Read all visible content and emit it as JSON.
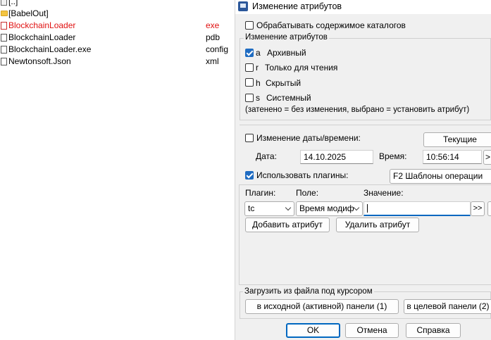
{
  "files": [
    {
      "name": "[..]",
      "ext": "",
      "icon": "up-dir-icon",
      "color": "#000000"
    },
    {
      "name": "[BabelOut]",
      "ext": "",
      "icon": "folder-icon",
      "color": "#000000"
    },
    {
      "name": "BlockchainLoader",
      "ext": "exe",
      "icon": "executable-file-icon",
      "color": "#e01010"
    },
    {
      "name": "BlockchainLoader",
      "ext": "pdb",
      "icon": "file-icon",
      "color": "#000000"
    },
    {
      "name": "BlockchainLoader.exe",
      "ext": "config",
      "icon": "file-icon",
      "color": "#000000"
    },
    {
      "name": "Newtonsoft.Json",
      "ext": "xml",
      "icon": "file-icon",
      "color": "#000000"
    }
  ],
  "dialog": {
    "title": "Изменение атрибутов",
    "process_subdirs_label": "Обрабатывать содержимое каталогов",
    "attributes_group_label": "Изменение атрибутов",
    "attributes": [
      {
        "key": "a",
        "label": "Архивный",
        "checked": true
      },
      {
        "key": "r",
        "label": "Только для чтения",
        "checked": false
      },
      {
        "key": "h",
        "label": "Скрытый",
        "checked": false
      },
      {
        "key": "s",
        "label": "Системный",
        "checked": false
      }
    ],
    "attributes_hint": "(затенено = без изменения, выбрано = установить атрибут)",
    "datetime_label": "Изменение даты/времени:",
    "current_button": "Текущие",
    "date_label": "Дата:",
    "date_value": "14.10.2025",
    "time_label": "Время:",
    "time_value": "10:56:14",
    "time_more_button": ">",
    "use_plugins_label": "Использовать плагины:",
    "plugin_templates_value": "F2 Шаблоны операции",
    "plugin_col_label": "Плагин:",
    "field_col_label": "Поле:",
    "value_col_label": "Значение:",
    "plugin_value": "tc",
    "field_value": "Время модиф",
    "value_input": "",
    "expand_button": ">>",
    "add_attr_button": "Добавить атрибут",
    "remove_attr_button": "Удалить атрибут",
    "load_from_file_label": "Загрузить из файла под курсором",
    "source_panel_button": "в исходной (активной) панели (1)",
    "target_panel_button": "в целевой панели (2)",
    "ok_button": "OK",
    "cancel_button": "Отмена",
    "help_button": "Справка",
    "accent_color": "#0067c0"
  }
}
